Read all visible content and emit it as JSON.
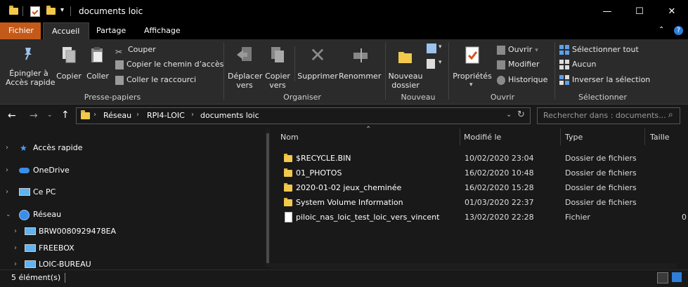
{
  "window": {
    "title": "documents loic",
    "controls": {
      "minimize": "—",
      "maximize": "☐",
      "close": "✕"
    }
  },
  "tabs": [
    "Fichier",
    "Accueil",
    "Partage",
    "Affichage"
  ],
  "ribbon": {
    "presse_papiers": {
      "pin": "Épingler à\nAccès rapide",
      "copy": "Copier",
      "paste": "Coller",
      "cut": "Couper",
      "copy_path": "Copier le chemin d’accès",
      "paste_shortcut": "Coller le raccourci",
      "group": "Presse-papiers"
    },
    "organiser": {
      "move": "Déplacer\nvers",
      "copy_to": "Copier\nvers",
      "delete": "Supprimer",
      "rename": "Renommer",
      "group": "Organiser"
    },
    "nouveau": {
      "new_folder": "Nouveau\ndossier",
      "group": "Nouveau"
    },
    "ouvrir": {
      "properties": "Propriétés",
      "open": "Ouvrir",
      "edit": "Modifier",
      "history": "Historique",
      "group": "Ouvrir"
    },
    "selectionner": {
      "select_all": "Sélectionner tout",
      "none": "Aucun",
      "invert": "Inverser la sélection",
      "group": "Sélectionner"
    }
  },
  "address": {
    "crumbs": [
      "Réseau",
      "RPI4-LOIC",
      "documents loic"
    ],
    "search_placeholder": "Rechercher dans : documents..."
  },
  "nav": [
    {
      "label": "Accès rapide",
      "icon": "star-icon"
    },
    {
      "label": "OneDrive",
      "icon": "cloud-icon"
    },
    {
      "label": "Ce PC",
      "icon": "computer-icon"
    },
    {
      "label": "Réseau",
      "icon": "network-icon"
    },
    {
      "label": "BRW0080929478EA",
      "icon": "computer-icon"
    },
    {
      "label": "FREEBOX",
      "icon": "computer-icon"
    },
    {
      "label": "LOIC-BUREAU",
      "icon": "computer-icon"
    }
  ],
  "columns": {
    "name": "Nom",
    "modified": "Modifié le",
    "type": "Type",
    "size": "Taille"
  },
  "files": [
    {
      "name": "$RECYCLE.BIN",
      "modified": "10/02/2020 23:04",
      "type": "Dossier de fichiers",
      "size": "",
      "kind": "folder"
    },
    {
      "name": "01_PHOTOS",
      "modified": "16/02/2020 10:48",
      "type": "Dossier de fichiers",
      "size": "",
      "kind": "folder"
    },
    {
      "name": "2020-01-02 jeux_cheminée",
      "modified": "16/02/2020 15:28",
      "type": "Dossier de fichiers",
      "size": "",
      "kind": "folder"
    },
    {
      "name": "System Volume Information",
      "modified": "01/03/2020 22:37",
      "type": "Dossier de fichiers",
      "size": "",
      "kind": "folder"
    },
    {
      "name": "piloic_nas_loic_test_loic_vers_vincent",
      "modified": "13/02/2020 22:28",
      "type": "Fichier",
      "size": "0",
      "kind": "file"
    }
  ],
  "status": {
    "count": "5 élément(s)"
  }
}
